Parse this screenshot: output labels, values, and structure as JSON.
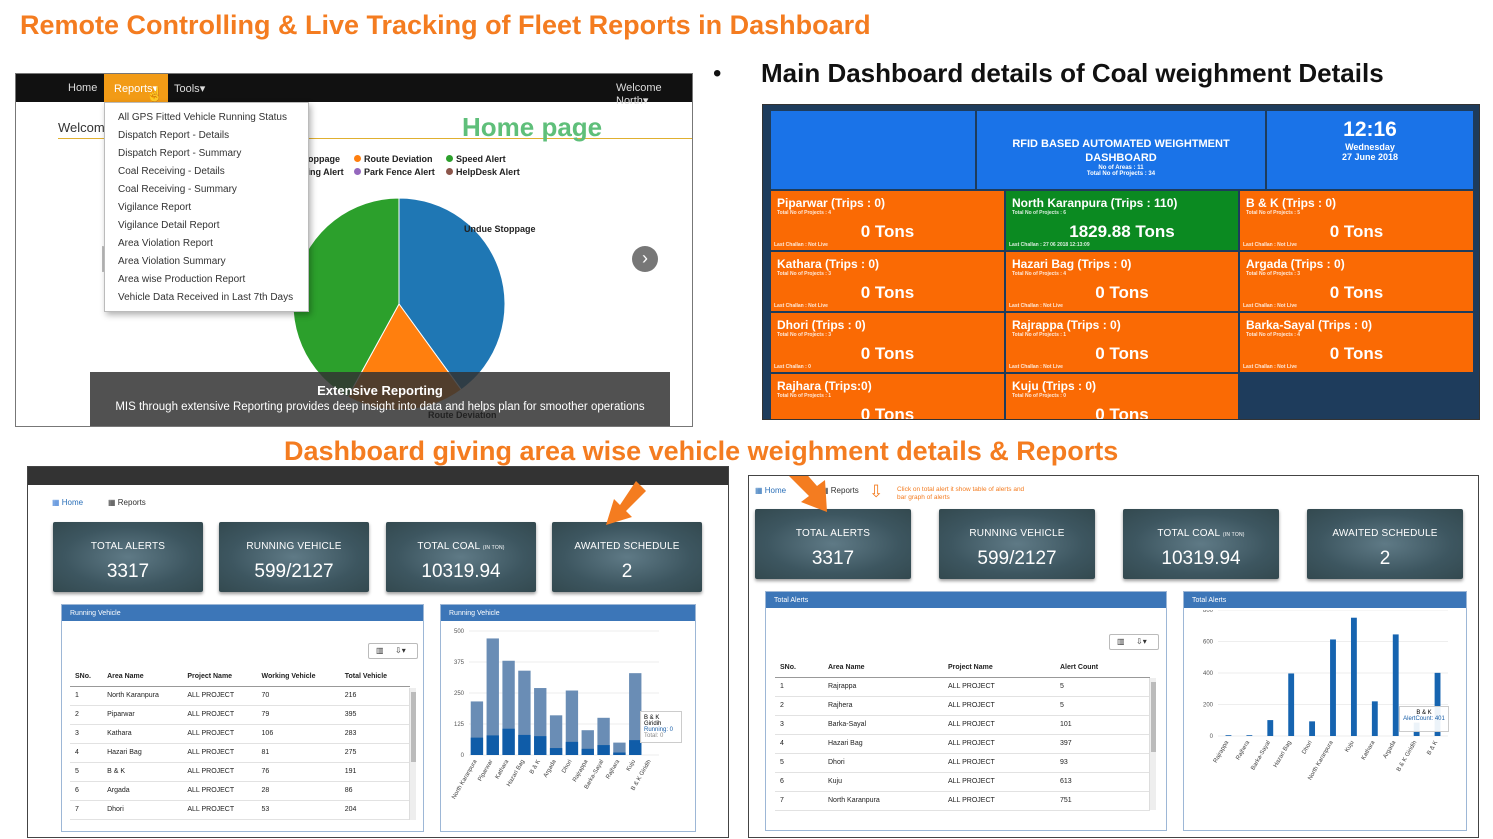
{
  "titles": {
    "main": "Remote Controlling &  Live Tracking of Fleet Reports in Dashboard",
    "section": "Dashboard giving area wise vehicle weighment details  & Reports",
    "bullet": "•",
    "bullet_text": "Main Dashboard details of Coal weighment Details"
  },
  "home_panel": {
    "nav": {
      "home": "Home",
      "reports": "Reports",
      "tools": "Tools",
      "welcome": "Welcome North"
    },
    "welcome_label": "Welcom",
    "home_page_label": "Home page",
    "menu_items": [
      "All GPS Fitted Vehicle Running Status",
      "Dispatch Report - Details",
      "Dispatch Report - Summary",
      "Coal Receiving - Details",
      "Coal Receiving - Summary",
      "Vigilance Report",
      "Vigilance Detail Report",
      "Area Violation Report",
      "Area Violation Summary",
      "Area wise Production Report",
      "Vehicle Data Received in Last 7th Days"
    ],
    "legend": {
      "stoppage": "Stoppage",
      "route_deviation": "Route Deviation",
      "speed_alert": "Speed Alert",
      "ring_alert": "ring Alert",
      "park_fence": "Park Fence Alert",
      "helpdesk": "HelpDesk Alert"
    },
    "pie_labels": {
      "undue": "Undue Stoppage",
      "route": "Route Deviation"
    },
    "banner_title": "Extensive Reporting",
    "banner_text": "MIS through extensive Reporting provides deep insight into data and helps plan for smoother operations",
    "colors": {
      "blue": "#1f77b4",
      "orange": "#ff7f0e",
      "green": "#2ca02c",
      "purple": "#9467bd",
      "brown": "#8c564b"
    }
  },
  "rfid": {
    "title": "RFID BASED AUTOMATED WEIGHTMENT DASHBOARD",
    "sub1": "No of Areas : 11",
    "sub2": "Total No of Projects : 34",
    "time": "12:16",
    "day": "Wednesday",
    "date": "27 June 2018",
    "tiles": [
      {
        "title": "Piparwar  (Trips : 0)",
        "sub": "Total No of Projects : 4",
        "value": "0 Tons",
        "last": "Last Challan : Not Live",
        "color": "#fa6a04"
      },
      {
        "title": "North Karanpura  (Trips : 110)",
        "sub": "Total No of Projects : 6",
        "value": "1829.88 Tons",
        "last": "Last Challan : 27 06 2018 12:13:09",
        "color": "#0b8a21"
      },
      {
        "title": "B & K  (Trips : 0)",
        "sub": "Total No of Projects : 5",
        "value": "0 Tons",
        "last": "Last Challan : Not Live",
        "color": "#fa6a04"
      },
      {
        "title": "Kathara  (Trips : 0)",
        "sub": "Total No of Projects : 3",
        "value": "0 Tons",
        "last": "Last Challan : Not Live",
        "color": "#fa6a04"
      },
      {
        "title": "Hazari Bag  (Trips : 0)",
        "sub": "Total No of Projects : 4",
        "value": "0 Tons",
        "last": "Last Challan : Not Live",
        "color": "#fa6a04"
      },
      {
        "title": "Argada  (Trips : 0)",
        "sub": "Total No of Projects : 3",
        "value": "0 Tons",
        "last": "Last Challan : Not Live",
        "color": "#fa6a04"
      },
      {
        "title": "Dhori  (Trips : 0)",
        "sub": "Total No of Projects : 3",
        "value": "0 Tons",
        "last": "Last Challan : 0",
        "color": "#fa6a04"
      },
      {
        "title": "Rajrappa  (Trips : 0)",
        "sub": "Total No of Projects : 1",
        "value": "0 Tons",
        "last": "Last Challan : Not Live",
        "color": "#fa6a04"
      },
      {
        "title": "Barka-Sayal  (Trips : 0)",
        "sub": "Total No of Projects : 4",
        "value": "0 Tons",
        "last": "Last Challan : Not Live",
        "color": "#fa6a04"
      },
      {
        "title": "Rajhara  (Trips:0)",
        "sub": "Total No of Projects : 1",
        "value": "0 Tons",
        "last": "",
        "color": "#fa6a04"
      },
      {
        "title": "Kuju  (Trips : 0)",
        "sub": "Total No of Projects : 0",
        "value": "0 Tons",
        "last": "",
        "color": "#fa6a04"
      }
    ]
  },
  "dash_left": {
    "crumb_home": "Home",
    "crumb_reports": "Reports",
    "cards": [
      {
        "label": "TOTAL ALERTS",
        "value": "3317"
      },
      {
        "label": "RUNNING VEHICLE",
        "value": "599/2127"
      },
      {
        "label": "TOTAL COAL",
        "suffix": "(IN TON)",
        "value": "10319.94"
      },
      {
        "label": "AWAITED SCHEDULE",
        "value": "2"
      }
    ],
    "table_title": "Running Vehicle",
    "chart_title": "Running Vehicle",
    "columns": [
      "SNo.",
      "Area Name",
      "Project Name",
      "Working Vehicle",
      "Total Vehicle"
    ],
    "rows": [
      [
        "1",
        "North Karanpura",
        "ALL PROJECT",
        "70",
        "216"
      ],
      [
        "2",
        "Piparwar",
        "ALL PROJECT",
        "79",
        "395"
      ],
      [
        "3",
        "Kathara",
        "ALL PROJECT",
        "106",
        "283"
      ],
      [
        "4",
        "Hazari Bag",
        "ALL PROJECT",
        "81",
        "275"
      ],
      [
        "5",
        "B & K",
        "ALL PROJECT",
        "76",
        "191"
      ],
      [
        "6",
        "Argada",
        "ALL PROJECT",
        "28",
        "86"
      ],
      [
        "7",
        "Dhori",
        "ALL PROJECT",
        "53",
        "204"
      ]
    ],
    "tooltip": {
      "title": "B & K Giridih",
      "running": "Running: 0",
      "total": "Total: 0"
    }
  },
  "dash_right": {
    "crumb_home": "Home",
    "crumb_reports": "Reports",
    "hint": "Click on total alert it show table of alerts and bar graph of alerts",
    "cards": [
      {
        "label": "TOTAL ALERTS",
        "value": "3317"
      },
      {
        "label": "RUNNING VEHICLE",
        "value": "599/2127"
      },
      {
        "label": "TOTAL COAL",
        "suffix": "(IN TON)",
        "value": "10319.94"
      },
      {
        "label": "AWAITED SCHEDULE",
        "value": "2"
      }
    ],
    "table_title": "Total Alerts",
    "chart_title": "Total Alerts",
    "columns": [
      "SNo.",
      "Area Name",
      "Project Name",
      "Alert Count"
    ],
    "rows": [
      [
        "1",
        "Rajrappa",
        "ALL PROJECT",
        "5"
      ],
      [
        "2",
        "Rajhera",
        "ALL PROJECT",
        "5"
      ],
      [
        "3",
        "Barka-Sayal",
        "ALL PROJECT",
        "101"
      ],
      [
        "4",
        "Hazari Bag",
        "ALL PROJECT",
        "397"
      ],
      [
        "5",
        "Dhori",
        "ALL PROJECT",
        "93"
      ],
      [
        "6",
        "Kuju",
        "ALL PROJECT",
        "613"
      ],
      [
        "7",
        "North Karanpura",
        "ALL PROJECT",
        "751"
      ]
    ],
    "tooltip": {
      "title": "B & K",
      "count": "AlertCount: 401"
    }
  },
  "chart_data": [
    {
      "type": "pie",
      "categories": [
        "Undue Stoppage",
        "Route Deviation",
        "Speed Alert"
      ],
      "values": [
        40,
        18,
        42
      ],
      "colors": [
        "#1f77b4",
        "#ff7f0e",
        "#2ca02c"
      ]
    },
    {
      "type": "bar",
      "categories": [
        "North Karanpura",
        "Piparwar",
        "Kathara",
        "Hazari Bag",
        "B & K",
        "Argada",
        "Dhori",
        "Rajrappa",
        "Barka-Sayal",
        "Rajhara",
        "Kuju",
        "B & K Giridih"
      ],
      "series": [
        {
          "name": "Total",
          "values": [
            216,
            470,
            380,
            340,
            270,
            160,
            260,
            100,
            150,
            50,
            330,
            0
          ]
        },
        {
          "name": "Running",
          "values": [
            70,
            79,
            106,
            81,
            76,
            28,
            53,
            25,
            40,
            10,
            60,
            0
          ]
        }
      ],
      "yticks": [
        "0",
        "125",
        "250",
        "375",
        "500"
      ],
      "ylim": [
        0,
        500
      ]
    },
    {
      "type": "bar",
      "categories": [
        "Rajrappa",
        "Rajhera",
        "Barka-Sayal",
        "Hazari Bag",
        "Dhori",
        "North Karanpura",
        "Kuju",
        "Kathara",
        "Argada",
        "B & K Giridih",
        "B & K"
      ],
      "values": [
        5,
        5,
        101,
        397,
        93,
        613,
        751,
        220,
        645,
        85,
        401
      ],
      "yticks": [
        "0",
        "200",
        "400",
        "600",
        "800"
      ],
      "ylim": [
        0,
        800
      ]
    }
  ]
}
